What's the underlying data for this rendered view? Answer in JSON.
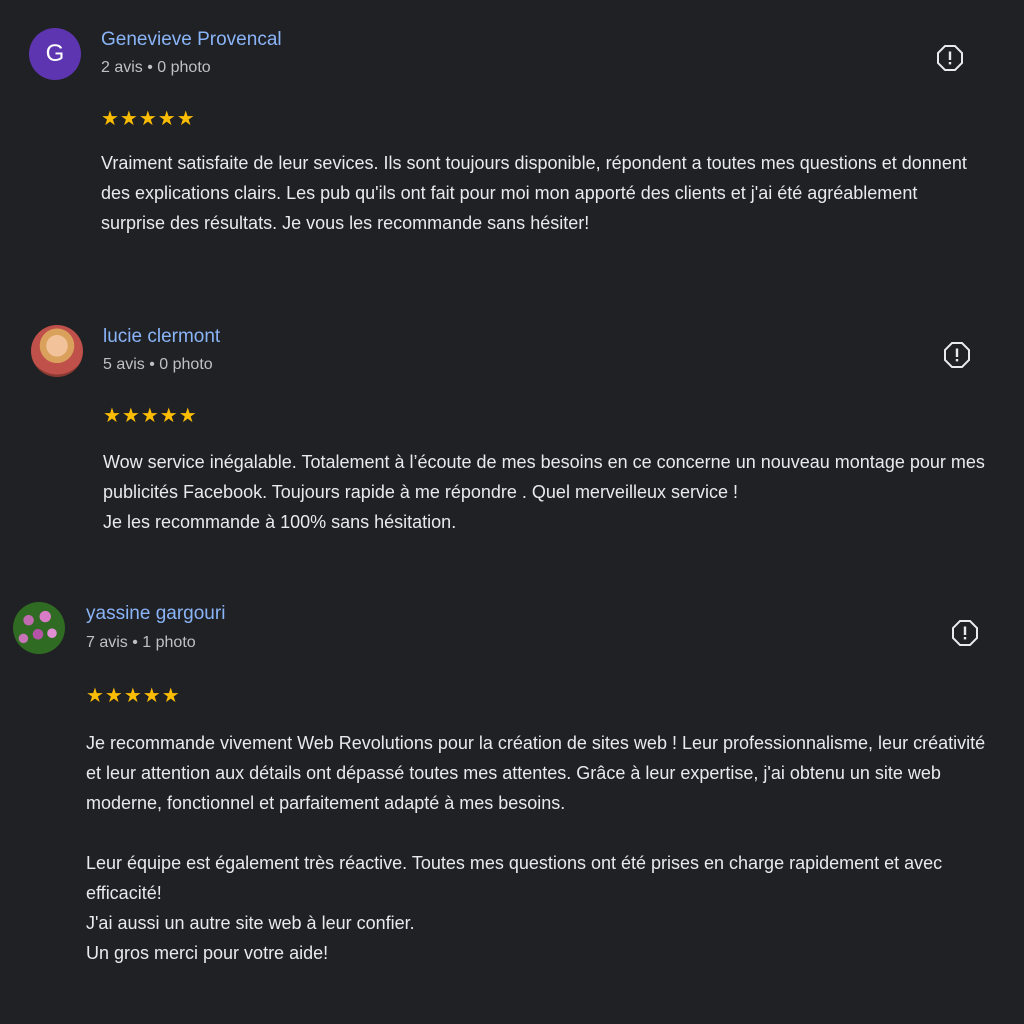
{
  "reviews": [
    {
      "name": "Genevieve Provencal",
      "avatar_letter": "G",
      "meta": "2 avis • 0 photo",
      "stars": "★★★★★",
      "rating": 5,
      "text": "Vraiment satisfaite de leur sevices. Ils sont toujours disponible, répondent a toutes mes questions et donnent des explications clairs. Les pub qu'ils ont fait pour moi mon apporté des clients et j'ai été agréablement surprise des résultats. Je vous les recommande sans hésiter!"
    },
    {
      "name": "lucie clermont",
      "meta": "5 avis • 0 photo",
      "stars": "★★★★★",
      "rating": 5,
      "text": "Wow service inégalable. Totalement à l’écoute de mes besoins en ce concerne un nouveau montage pour mes publicités Facebook. Toujours rapide à me répondre . Quel merveilleux service !\nJe les recommande à 100% sans hésitation."
    },
    {
      "name": "yassine gargouri",
      "meta": "7 avis • 1 photo",
      "stars": "★★★★★",
      "rating": 5,
      "text": "Je recommande vivement Web Revolutions pour la création de sites web ! Leur professionnalisme, leur créativité et leur attention aux détails ont dépassé toutes mes attentes. Grâce à leur expertise, j'ai obtenu un site web moderne, fonctionnel et parfaitement adapté à mes besoins.\n\nLeur équipe est également très réactive. Toutes mes questions ont été prises en charge rapidement et avec efficacité!\nJ'ai aussi un autre site web à leur confier.\nUn gros merci pour votre aide!"
    }
  ],
  "colors": {
    "background": "#202124",
    "name": "#8ab4f8",
    "star": "#fbbc04",
    "text": "#e8eaed",
    "meta": "#bdc1c6"
  },
  "icons": {
    "flag": "report-icon"
  }
}
